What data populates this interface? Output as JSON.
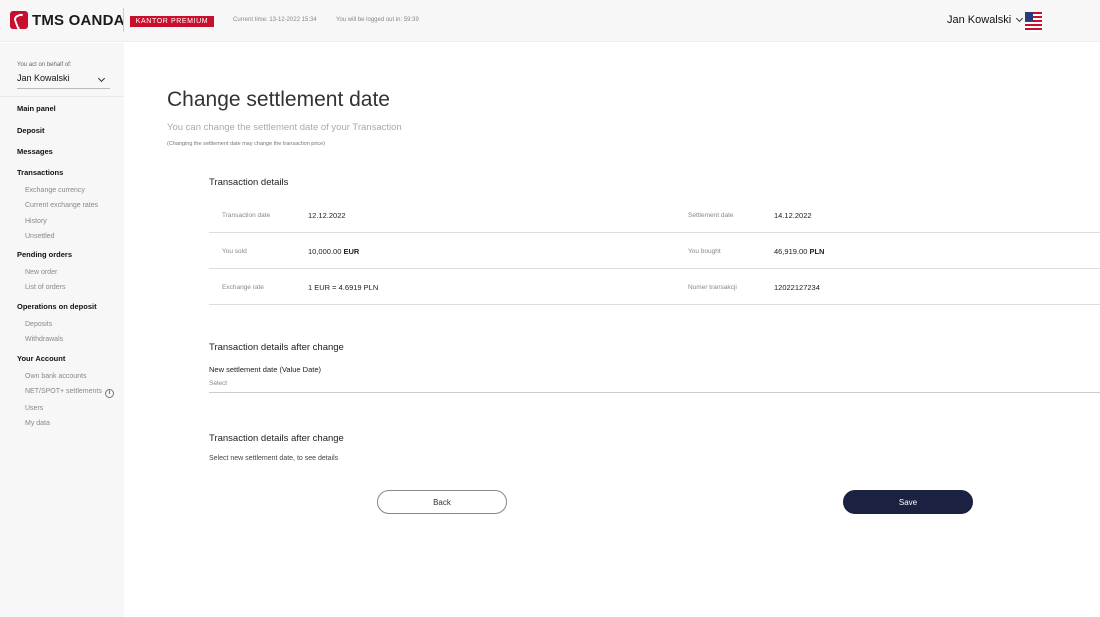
{
  "header": {
    "brand": "TMS OANDA",
    "badge": "KANTOR PREMIUM",
    "current_time": "Current time: 13-12-2022 15:34",
    "logout_timer": "You will be logged out in: 59:39",
    "user_name": "Jan Kowalski",
    "flag_icon": "us-flag-icon"
  },
  "sidebar": {
    "acting_label": "You act on behalf of:",
    "acting_value": "Jan Kowalski",
    "nav": {
      "main_panel": "Main panel",
      "deposit": "Deposit",
      "messages": "Messages",
      "transactions": "Transactions",
      "exchange_currency": "Exchange currency",
      "current_rates": "Current exchange rates",
      "history": "History",
      "unsettled": "Unsettled",
      "pending_orders": "Pending orders",
      "new_order": "New order",
      "list_of_orders": "List of orders",
      "operations_on_deposit": "Operations on deposit",
      "deposits": "Deposits",
      "withdrawals": "Withdrawals",
      "your_account": "Your Account",
      "own_bank_accounts": "Own bank accounts",
      "netspot_settlements": "NET/SPOT+ settlements",
      "users": "Users",
      "my_data": "My data"
    }
  },
  "main": {
    "title": "Change settlement date",
    "subtitle": "You can change the settlement date of your Transaction",
    "note": "(Changing the settlement date may change the transaction price)",
    "details_title": "Transaction details",
    "details": {
      "transaction_date_label": "Transaction date",
      "transaction_date_value": "12.12.2022",
      "settlement_date_label": "Settlement date",
      "settlement_date_value": "14.12.2022",
      "sold_label": "You sold",
      "sold_amount": "10,000.00",
      "sold_currency": "EUR",
      "bought_label": "You bought",
      "bought_amount": "46,919.00",
      "bought_currency": "PLN",
      "rate_label": "Exchange rate",
      "rate_value": "1 EUR = 4.6919 PLN",
      "number_label": "Numer transakcji",
      "number_value": "12022127234"
    },
    "after_change_title_1": "Transaction details after change",
    "new_date_label": "New settlement date (Value Date)",
    "new_date_placeholder": "Select",
    "after_change_title_2": "Transaction details after change",
    "hint": "Select new settlement date, to see details",
    "back_label": "Back",
    "save_label": "Save"
  }
}
